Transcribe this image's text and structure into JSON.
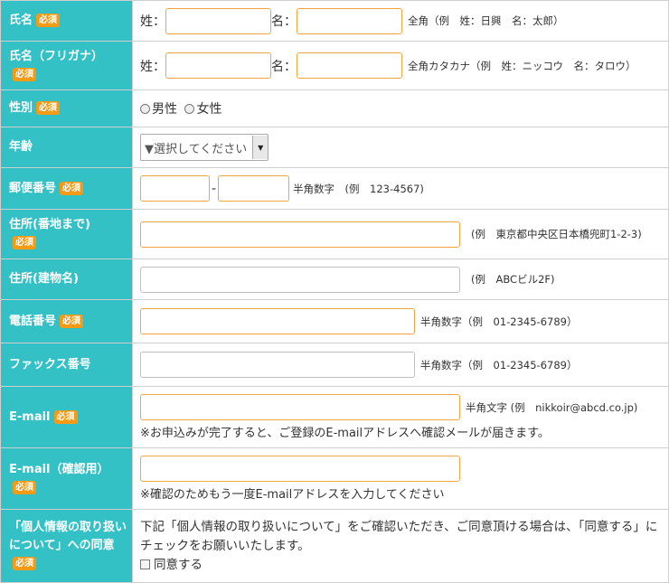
{
  "required_badge": "必須",
  "rows": {
    "name": {
      "label": "氏名",
      "last_prefix": "姓：",
      "first_prefix": "名：",
      "note": "全角（例　姓：日興　名：太郎）"
    },
    "kana": {
      "label": "氏名（フリガナ）",
      "last_prefix": "姓：",
      "first_prefix": "名：",
      "note": "全角カタカナ（例　姓：ニッコウ　名：タロウ）"
    },
    "gender": {
      "label": "性別",
      "male": "男性",
      "female": "女性"
    },
    "age": {
      "label": "年齢",
      "select_value": "▼選択してください",
      "arrow": "▼"
    },
    "postal": {
      "label": "郵便番号",
      "dash": "-",
      "note": "半角数字　(例　123-4567)"
    },
    "address": {
      "label": "住所(番地まで)",
      "note": "(例　東京都中央区日本橋兜町1-2-3)"
    },
    "building": {
      "label": "住所(建物名)",
      "note": "(例　ABCビル2F)"
    },
    "phone": {
      "label": "電話番号",
      "note": "半角数字（例　01-2345-6789）"
    },
    "fax": {
      "label": "ファックス番号",
      "note": "半角数字（例　01-2345-6789）"
    },
    "email": {
      "label": "E-mail",
      "note": "半角文字 (例　nikkoir@abcd.co.jp)",
      "help": "※お申込みが完了すると、ご登録のE-mailアドレスへ確認メールが届きます。"
    },
    "email_confirm": {
      "label": "E-mail（確認用）",
      "help": "※確認のためもう一度E-mailアドレスを入力してください"
    },
    "privacy": {
      "label": "「個人情報の取り扱いについて」への同意",
      "text": "下記「個人情報の取り扱いについて」をご確認いただき、ご同意頂ける場合は、「同意する」にチェックをお願いいたします。",
      "checkbox_label": "同意する"
    }
  },
  "colors": {
    "label_bg": "#33c1c6",
    "badge": "#f59a14",
    "input_border": "#f0a742"
  }
}
